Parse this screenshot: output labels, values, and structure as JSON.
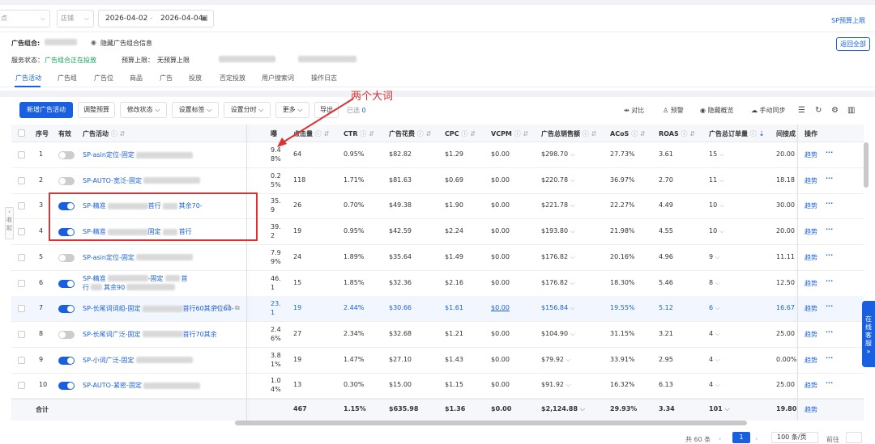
{
  "filter": {
    "select1_value": "点",
    "select2_value": "店铺",
    "date_start": "2026-04-02",
    "date_sep": "-",
    "date_end": "2026-04-04",
    "budget_link": "SP预算上限"
  },
  "info": {
    "group_label": "广告组合:",
    "hide_info": "隐藏广告组合信息",
    "status_label": "服务状态：",
    "status_value": "广告组合正在投放",
    "budget_label": "预算上限：",
    "budget_value": "无预算上限",
    "back_all": "返回全部"
  },
  "tabs": [
    "广告活动",
    "广告组",
    "广告位",
    "商品",
    "广告",
    "投放",
    "否定投放",
    "用户搜索词",
    "操作日志"
  ],
  "toolbar": {
    "new_campaign": "新增广告活动",
    "adjust_budget": "调整预算",
    "modify_status": "修改状态",
    "set_tag": "设置标签",
    "set_timeshare": "设置分时",
    "more": "更多",
    "export": "导出",
    "selected": "已选",
    "selected_count": "0",
    "compare": "对比",
    "alert": "预警",
    "hide_overview": "隐藏概览",
    "manual_sync": "手动同步"
  },
  "annotation": "两个大词",
  "columns": {
    "index": "序号",
    "enabled": "有效",
    "campaign": "广告活动",
    "col_partial": "曝",
    "clicks": "点击量",
    "ctr": "CTR",
    "spend": "广告花费",
    "cpc": "CPC",
    "vcpm": "VCPM",
    "sales": "广告总销售额",
    "acos": "ACoS",
    "roas": "ROAS",
    "orders": "广告总订单量",
    "cvr": "间接成",
    "ops": "操作"
  },
  "rows": [
    {
      "idx": "1",
      "on": false,
      "name1": "SP-asin定位-固定",
      "name2": "",
      "p1": "9.4",
      "p2": "8%",
      "clicks": "64",
      "ctr": "0.95%",
      "spend": "$82.82",
      "cpc": "$1.29",
      "vcpm": "$0.00",
      "sales": "$298.70",
      "acos": "27.73%",
      "roas": "3.61",
      "orders": "15",
      "cvr": "20.00",
      "trend": "趋势"
    },
    {
      "idx": "2",
      "on": false,
      "name1": "SP-AUTO-宽泛-固定",
      "name2": "",
      "p1": "0.2",
      "p2": "5%",
      "clicks": "118",
      "ctr": "1.71%",
      "spend": "$81.63",
      "cpc": "$0.69",
      "vcpm": "$0.00",
      "sales": "$220.78",
      "acos": "36.97%",
      "roas": "2.70",
      "orders": "11",
      "cvr": "18.18",
      "trend": "趋势"
    },
    {
      "idx": "3",
      "on": true,
      "name1": "SP-精准",
      "name1b": "首行",
      "name1c": "其余70-",
      "name2": "",
      "p1": "35.",
      "p2": "9",
      "clicks": "26",
      "ctr": "0.70%",
      "spend": "$49.38",
      "cpc": "$1.90",
      "vcpm": "$0.00",
      "sales": "$221.78",
      "acos": "22.27%",
      "roas": "4.49",
      "orders": "10",
      "cvr": "30.00",
      "trend": "趋势"
    },
    {
      "idx": "4",
      "on": true,
      "name1": "SP-精准",
      "name1b": "固定",
      "name1c": "首行",
      "name2": "",
      "p1": "39.",
      "p2": "2",
      "clicks": "19",
      "ctr": "0.95%",
      "spend": "$42.59",
      "cpc": "$2.24",
      "vcpm": "$0.00",
      "sales": "$193.80",
      "acos": "21.98%",
      "roas": "4.55",
      "orders": "10",
      "cvr": "20.00",
      "trend": "趋势"
    },
    {
      "idx": "5",
      "on": false,
      "name1": "SP-asin定位-固定",
      "name2": "",
      "p1": "7.9",
      "p2": "9%",
      "clicks": "24",
      "ctr": "1.89%",
      "spend": "$35.64",
      "cpc": "$1.49",
      "vcpm": "$0.00",
      "sales": "$176.82",
      "acos": "20.16%",
      "roas": "4.96",
      "orders": "9",
      "cvr": "11.11",
      "trend": "趋势"
    },
    {
      "idx": "6",
      "on": true,
      "name1": "SP-精准",
      "name1b": "-固定",
      "name1c": "首",
      "name2": "行",
      "name2b": "其余90",
      "p1": "46.",
      "p2": "1",
      "clicks": "15",
      "ctr": "1.85%",
      "spend": "$32.36",
      "cpc": "$2.16",
      "vcpm": "$0.00",
      "sales": "$176.82",
      "acos": "18.30%",
      "roas": "5.46",
      "orders": "8",
      "cvr": "12.50",
      "trend": "趋势"
    },
    {
      "idx": "7",
      "on": true,
      "name1": "SP-长尾词词组-固定",
      "name1b": "首行60其余位60-",
      "name2": "",
      "p1": "23.",
      "p2": "1",
      "clicks": "19",
      "ctr": "2.44%",
      "spend": "$30.66",
      "cpc": "$1.61",
      "vcpm": "$0.00",
      "sales": "$156.84",
      "acos": "19.55%",
      "roas": "5.12",
      "orders": "6",
      "cvr": "16.67",
      "trend": "趋势"
    },
    {
      "idx": "8",
      "on": false,
      "name1": "SP-长尾词广泛-固定",
      "name1b": "首行70其余",
      "name2": "",
      "p1": "2.4",
      "p2": "6%",
      "clicks": "27",
      "ctr": "2.34%",
      "spend": "$32.68",
      "cpc": "$1.21",
      "vcpm": "$0.00",
      "sales": "$104.90",
      "acos": "31.15%",
      "roas": "3.21",
      "orders": "4",
      "cvr": "25.00",
      "trend": "趋势"
    },
    {
      "idx": "9",
      "on": true,
      "name1": "SP-小词广泛-固定",
      "name2": "",
      "p1": "3.8",
      "p2": "1%",
      "clicks": "19",
      "ctr": "1.47%",
      "spend": "$27.10",
      "cpc": "$1.43",
      "vcpm": "$0.00",
      "sales": "$79.92",
      "acos": "33.91%",
      "roas": "2.95",
      "orders": "4",
      "cvr": "0.00%",
      "trend": "趋势"
    },
    {
      "idx": "10",
      "on": true,
      "name1": "SP-AUTO-紧密-固定",
      "name2": "",
      "p1": "1.0",
      "p2": "4%",
      "clicks": "13",
      "ctr": "0.30%",
      "spend": "$15.00",
      "cpc": "$1.15",
      "vcpm": "$0.00",
      "sales": "$91.92",
      "acos": "16.32%",
      "roas": "6.13",
      "orders": "4",
      "cvr": "25.00",
      "trend": "趋势"
    }
  ],
  "total": {
    "label": "合计",
    "clicks": "467",
    "ctr": "1.15%",
    "spend": "$635.98",
    "cpc": "$1.36",
    "vcpm": "$0.00",
    "sales": "$2,124.88",
    "acos": "29.93%",
    "roas": "3.34",
    "orders": "101",
    "cvr": "19.80",
    "trend": "趋势"
  },
  "pager": {
    "total": "共 60 条",
    "page": "1",
    "page_size": "100 条/页",
    "goto": "前往"
  },
  "side": {
    "collapse": "收起",
    "help": "在线客服"
  }
}
